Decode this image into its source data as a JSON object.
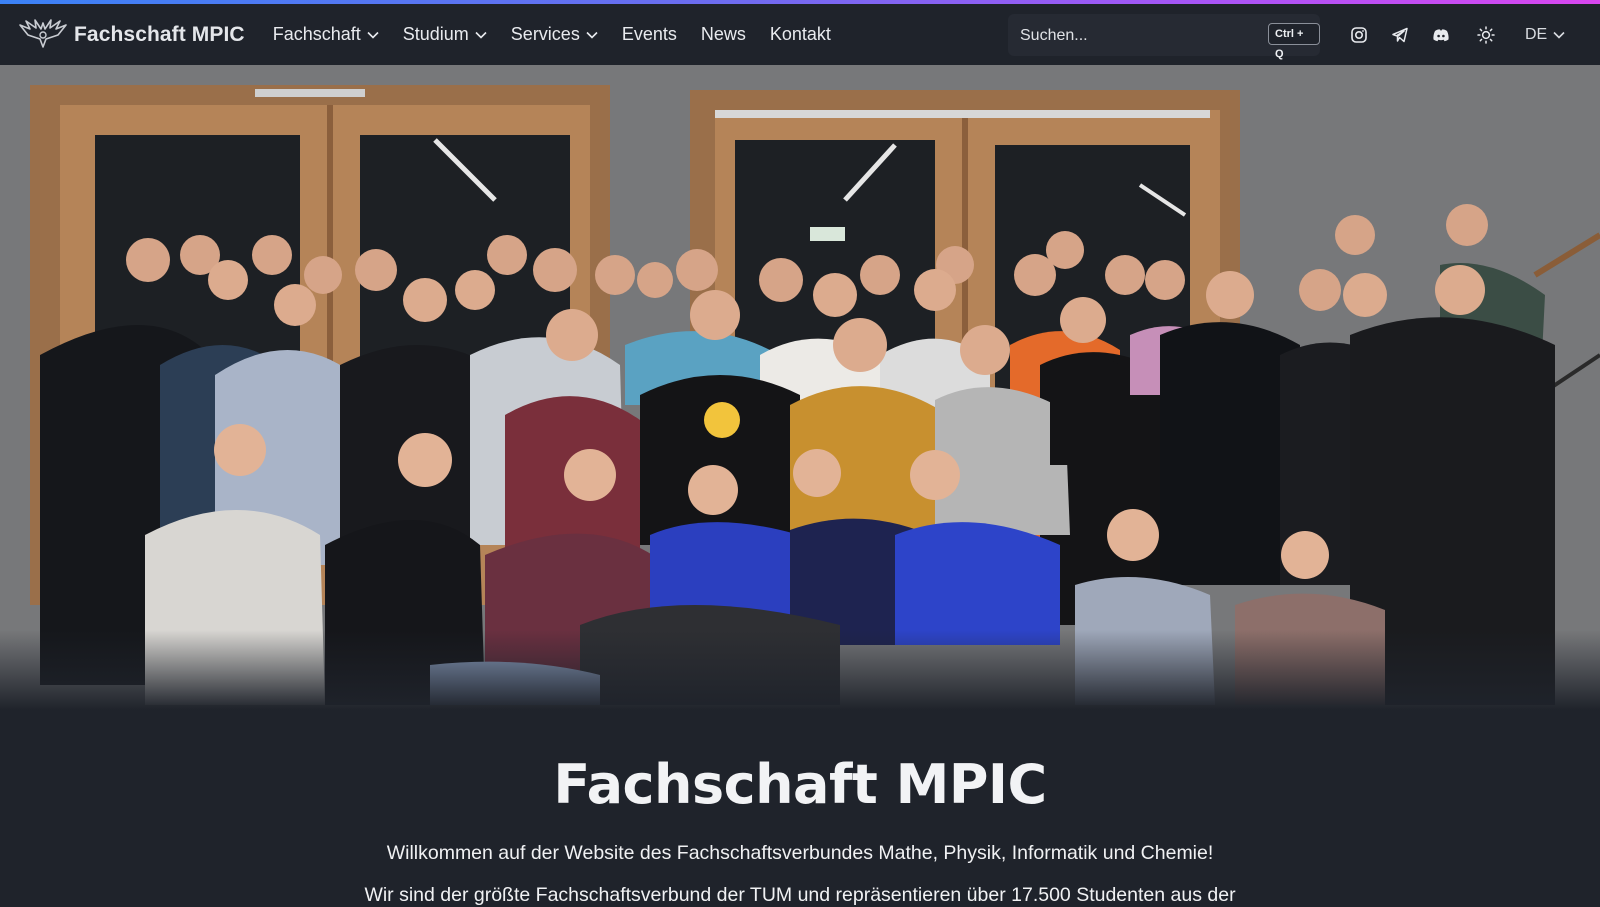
{
  "brand": {
    "name": "Fachschaft MPIC",
    "logo": "eagle-logo"
  },
  "nav": {
    "items": [
      {
        "label": "Fachschaft",
        "dropdown": true
      },
      {
        "label": "Studium",
        "dropdown": true
      },
      {
        "label": "Services",
        "dropdown": true
      },
      {
        "label": "Events",
        "dropdown": false
      },
      {
        "label": "News",
        "dropdown": false
      },
      {
        "label": "Kontakt",
        "dropdown": false
      }
    ]
  },
  "search": {
    "placeholder": "Suchen...",
    "shortcut": "Ctrl + Q"
  },
  "header_icons": [
    "instagram-icon",
    "telegram-icon",
    "discord-icon",
    "sun-icon"
  ],
  "language": "DE",
  "hero": {
    "image": "group-photo"
  },
  "main": {
    "title": "Fachschaft MPIC",
    "lead": "Willkommen auf der Website des Fachschaftsverbundes Mathe, Physik, Informatik und Chemie!",
    "lead2": "Wir sind der größte Fachschaftsverbund der TUM und repräsentieren über 17.500 Studenten aus der"
  },
  "colors": {
    "background": "#1f232b",
    "accent_gradient": [
      "#3b82f6",
      "#a855f7",
      "#d946ef"
    ]
  }
}
